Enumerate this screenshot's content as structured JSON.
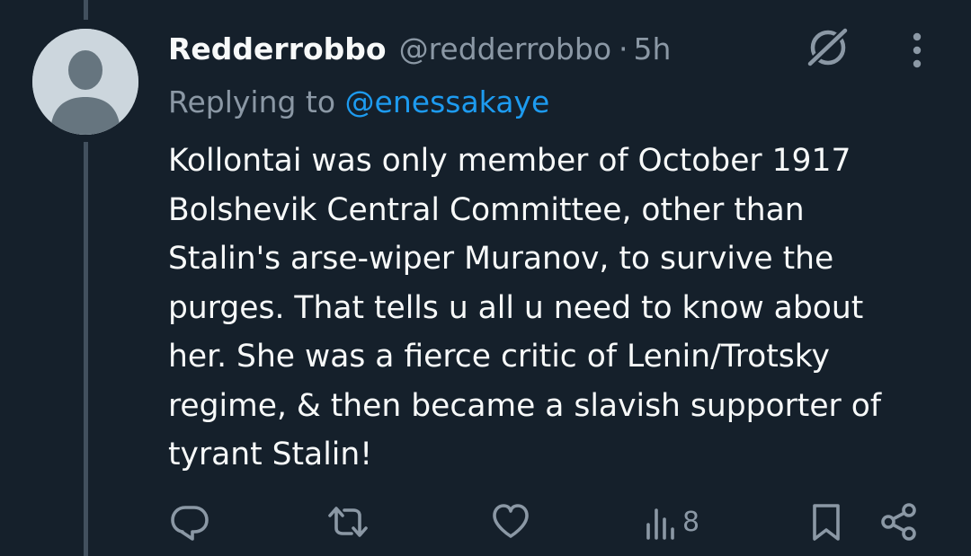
{
  "tweet": {
    "author_name": "Redderrobbo",
    "handle": "@redderrobbo",
    "separator": "·",
    "time": "5h",
    "replying_prefix": "Replying to",
    "replying_handle": "@enessakaye",
    "lines": [
      "Kollontai was only member of October 1917",
      "Bolshevik Central Committee, other than",
      "Stalin's arse-wiper Muranov, to survive the",
      "purges. That tells u all u need to know about",
      "her. She was a fierce critic of Lenin/Trotsky",
      "regime, & then became a slavish supporter of",
      "tyrant Stalin!"
    ]
  },
  "actions": {
    "views_count": "8"
  },
  "icons": {
    "reply": "reply-icon",
    "retweet": "retweet-icon",
    "like": "heart-icon",
    "views": "views-icon",
    "bookmark": "bookmark-icon",
    "share": "share-icon",
    "grok": "grok-icon",
    "more": "more-icon"
  },
  "colors": {
    "background": "#15202b",
    "text": "#f7f9f9",
    "secondary": "#8b98a5",
    "accent": "#1d9bf0",
    "thread_line": "#42505e"
  }
}
